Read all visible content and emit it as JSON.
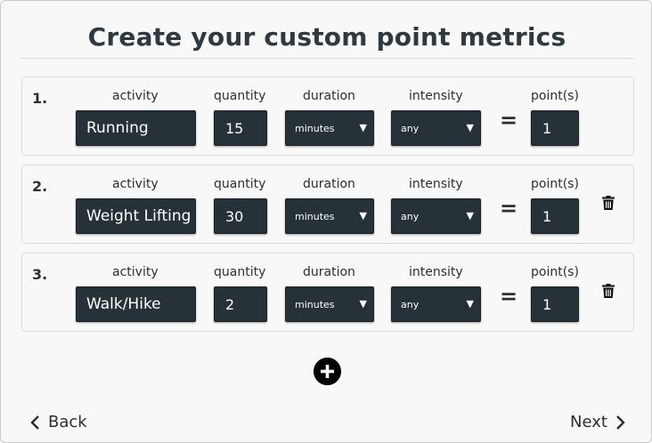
{
  "title": "Create your custom point metrics",
  "columns": {
    "activity": "activity",
    "quantity": "quantity",
    "duration": "duration",
    "intensity": "intensity",
    "points": "point(s)"
  },
  "equals_sign": "=",
  "rows": [
    {
      "number": "1.",
      "activity": "Running",
      "quantity": "15",
      "duration": "minutes",
      "intensity": "any",
      "points": "1",
      "deletable": false
    },
    {
      "number": "2.",
      "activity": "Weight Lifting",
      "quantity": "30",
      "duration": "minutes",
      "intensity": "any",
      "points": "1",
      "deletable": true
    },
    {
      "number": "3.",
      "activity": "Walk/Hike",
      "quantity": "2",
      "duration": "minutes",
      "intensity": "any",
      "points": "1",
      "deletable": true
    }
  ],
  "icons": {
    "dropdown": "caret-down-icon",
    "delete": "trash-icon",
    "add": "plus-circle-icon",
    "back": "chevron-left-icon",
    "next": "chevron-right-icon"
  },
  "nav": {
    "back_label": "Back",
    "next_label": "Next"
  },
  "colors": {
    "field_bg": "#263238",
    "field_text": "#ffffff",
    "card_bg": "#f8f8f8",
    "text": "#2b2f33"
  }
}
